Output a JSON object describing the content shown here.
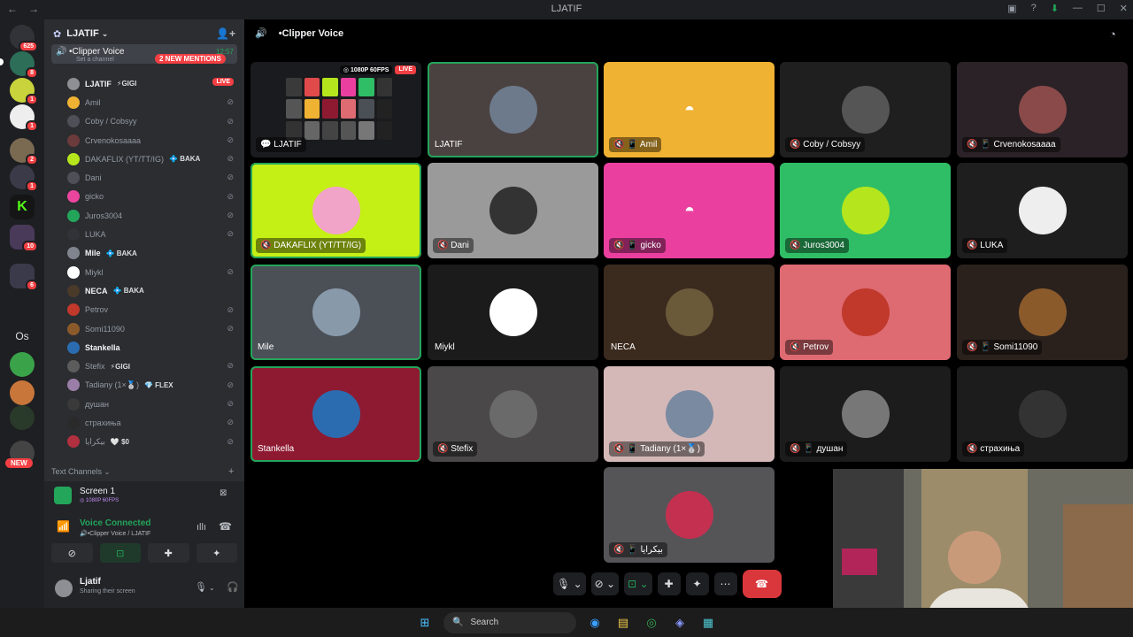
{
  "titlebar": {
    "title": "LJATIF",
    "back": "←",
    "forward": "→"
  },
  "servers": {
    "badges": [
      "625",
      "8",
      "1",
      "1",
      "2",
      "1",
      "1",
      "10",
      "6",
      "6"
    ],
    "folder_label": "Os",
    "new_label": "NEW"
  },
  "guild": {
    "name": "LJATIF"
  },
  "voice_channel": {
    "name": "•Clipper Voice",
    "time": "12:57",
    "sub": "Set a channel",
    "mentions": "2 NEW MENTIONS"
  },
  "members": [
    {
      "name": "LJATIF",
      "tag": "⚡GIGI",
      "live": "LIVE",
      "color": "#8d8f94",
      "bold": true
    },
    {
      "name": "Amil",
      "tag": "",
      "color": "#f0b232"
    },
    {
      "name": "Coby / Cobsyy",
      "tag": "",
      "color": "#4e5058"
    },
    {
      "name": "Crvenokosaaaa",
      "tag": "",
      "color": "#6b3a3a"
    },
    {
      "name": "DAKAFLIX (YT/TT/IG)",
      "tag": "💠 BAKA",
      "color": "#b5e61d"
    },
    {
      "name": "Dani",
      "tag": "",
      "color": "#4e5058"
    },
    {
      "name": "gicko",
      "tag": "",
      "color": "#eb459e"
    },
    {
      "name": "Juros3004",
      "tag": "",
      "color": "#23a55a"
    },
    {
      "name": "LUKA",
      "tag": "",
      "color": "#313338"
    },
    {
      "name": "Mile",
      "tag": "💠 BAKA",
      "color": "#80848e",
      "bold": true
    },
    {
      "name": "Miykl",
      "tag": "",
      "color": "#ffffff"
    },
    {
      "name": "NECA",
      "tag": "💠 BAKA",
      "color": "#4a3a2a",
      "bold": true
    },
    {
      "name": "Petrov",
      "tag": "",
      "color": "#c0392b"
    },
    {
      "name": "Somi11090",
      "tag": "",
      "color": "#8b5a2b"
    },
    {
      "name": "Stankella",
      "tag": "",
      "color": "#2b6cb0",
      "bold": true
    },
    {
      "name": "Stefix",
      "tag": "⚡GIGI",
      "color": "#5c5c5c"
    },
    {
      "name": "Tadiany (1×🥈)",
      "tag": "💎 FLEX",
      "color": "#9b7ea8"
    },
    {
      "name": "душан",
      "tag": "",
      "color": "#3a3a3a"
    },
    {
      "name": "страхиња",
      "tag": "",
      "color": "#2a2a2a"
    },
    {
      "name": "بيكرايا",
      "tag": "🤍 $0",
      "color": "#b03040"
    }
  ],
  "text_channels": {
    "label": "Text Channels"
  },
  "panel": {
    "screen_title": "Screen 1",
    "screen_quality": "◎ 1080P 60FPS",
    "voice_status": "Voice Connected",
    "voice_sub": "🔊•Clipper Voice / LJATIF",
    "user_name": "Ljatif",
    "user_status": "Sharing their screen"
  },
  "main": {
    "channel_title": "•Clipper Voice"
  },
  "tiles": [
    {
      "name": "LJATIF",
      "bg": "#1a1b1e",
      "stream": true,
      "icons": "💬"
    },
    {
      "name": "LJATIF",
      "bg": "#4a4240",
      "speaking": true,
      "icons": "",
      "avatar_color": "#6d7a8c"
    },
    {
      "name": "Amil",
      "bg": "#f0b232",
      "icons": "🔇 📱",
      "avatar_color": "#f0b232",
      "discord": true
    },
    {
      "name": "Coby / Cobsyy",
      "bg": "#1f1f1f",
      "icons": "🔇",
      "avatar_color": "#555"
    },
    {
      "name": "Crvenokosaaaa",
      "bg": "#2a2226",
      "icons": "🔇 📱",
      "avatar_color": "#8a4a4a"
    },
    {
      "name": "DAKAFLIX (YT/TT/IG)",
      "bg": "#c5f015",
      "icons": "🔇",
      "avatar_color": "#f2a3c8",
      "speaking": true
    },
    {
      "name": "Dani",
      "bg": "#9a9a9a",
      "icons": "🔇",
      "avatar_color": "#333"
    },
    {
      "name": "gicko",
      "bg": "#eb3fa0",
      "icons": "🔇 📱",
      "avatar_color": "#eb3fa0",
      "discord": true
    },
    {
      "name": "Juros3004",
      "bg": "#2fbe66",
      "icons": "🔇",
      "avatar_color": "#b5e61d"
    },
    {
      "name": "LUKA",
      "bg": "#1e1e1e",
      "icons": "🔇",
      "avatar_color": "#eee"
    },
    {
      "name": "Mile",
      "bg": "#4b5057",
      "icons": "",
      "avatar_color": "#8899aa",
      "speaking": true
    },
    {
      "name": "Miykl",
      "bg": "#1b1b1b",
      "icons": "",
      "avatar_color": "#ffffff"
    },
    {
      "name": "NECA",
      "bg": "#3b2a1e",
      "icons": "",
      "avatar_color": "#6b5a3a"
    },
    {
      "name": "Petrov",
      "bg": "#de6a72",
      "icons": "🔇",
      "avatar_color": "#c0392b"
    },
    {
      "name": "Somi11090",
      "bg": "#2a211d",
      "icons": "🔇 📱",
      "avatar_color": "#8b5a2b"
    },
    {
      "name": "Stankella",
      "bg": "#8e1a32",
      "icons": "",
      "avatar_color": "#2b6cb0",
      "speaking": true
    },
    {
      "name": "Stefix",
      "bg": "#4a4848",
      "icons": "🔇",
      "avatar_color": "#6a6a6a"
    },
    {
      "name": "Tadiany (1×🥈)",
      "bg": "#d4b8b8",
      "icons": "🔇 📱",
      "avatar_color": "#7a8aa0"
    },
    {
      "name": "душан",
      "bg": "#1c1c1c",
      "icons": "🔇 📱",
      "avatar_color": "#777"
    },
    {
      "name": "страхиња",
      "bg": "#1c1c1c",
      "icons": "🔇",
      "avatar_color": "#333"
    },
    {
      "name": "بيكرايا",
      "bg": "#555558",
      "icons": "🔇 📱",
      "avatar_color": "#c43050"
    }
  ],
  "stream_badge": {
    "quality": "◎ 1080P 60FPS",
    "live": "LIVE"
  },
  "taskbar": {
    "search_placeholder": "Search"
  }
}
